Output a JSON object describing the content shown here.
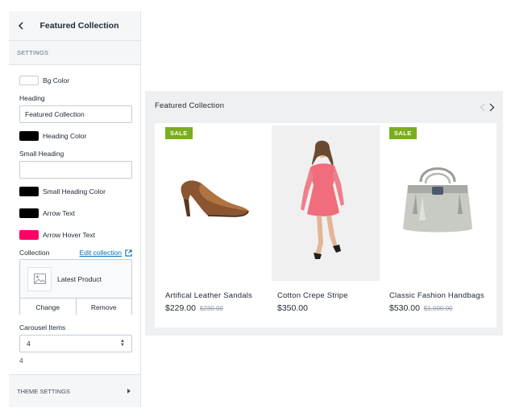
{
  "sidebar": {
    "title": "Featured Collection",
    "section_label": "SETTINGS",
    "bg_color": {
      "label": "Bg Color",
      "value": "#ffffff"
    },
    "heading": {
      "label": "Heading",
      "value": "Featured Collection"
    },
    "heading_color": {
      "label": "Heading Color",
      "value": "#000000"
    },
    "small_heading": {
      "label": "Small Heading",
      "value": ""
    },
    "small_heading_color": {
      "label": "Small Heading Color",
      "value": "#000000"
    },
    "arrow_text": {
      "label": "Arrow Text",
      "value": "#000000"
    },
    "arrow_hover_text": {
      "label": "Arrow Hover Text",
      "value": "#ff0066"
    },
    "collection": {
      "label": "Collection",
      "edit_link": "Edit collection",
      "name": "Latest Product",
      "change_label": "Change",
      "remove_label": "Remove"
    },
    "carousel": {
      "label": "Carousel Items",
      "selected": "4",
      "value_display": "4"
    },
    "theme_settings": "THEME SETTINGS"
  },
  "preview": {
    "title": "Featured Collection",
    "products": [
      {
        "name": "Artifical Leather Sandals",
        "price": "$229.00",
        "compare_price": "$230.00",
        "sale_label": "SALE"
      },
      {
        "name": "Cotton Crepe Stripe",
        "price": "$350.00",
        "compare_price": "",
        "sale_label": ""
      },
      {
        "name": "Classic Fashion Handbags",
        "price": "$530.00",
        "compare_price": "$1,000.00",
        "sale_label": "SALE"
      }
    ]
  },
  "colors": {
    "accent": "#006fbb",
    "sale_badge": "#7bad1f",
    "preview_bg": "#eff0f1"
  },
  "icons": [
    "back-icon",
    "external-link-icon",
    "image-placeholder-icon",
    "prev-arrow-icon",
    "next-arrow-icon",
    "chevron-right-icon"
  ]
}
